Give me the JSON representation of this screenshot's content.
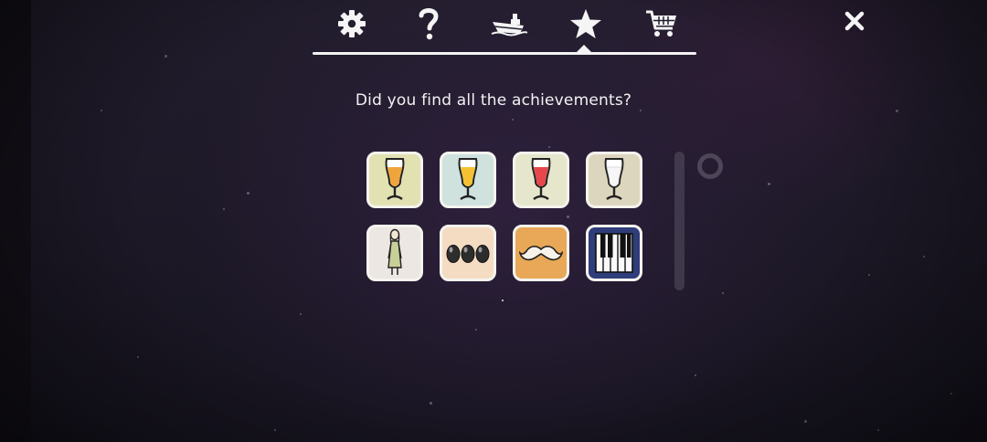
{
  "nav": {
    "tabs": [
      {
        "icon": "gear-icon",
        "active": false
      },
      {
        "icon": "help-icon",
        "active": false
      },
      {
        "icon": "boat-icon",
        "active": false
      },
      {
        "icon": "star-icon",
        "active": true
      },
      {
        "icon": "cart-icon",
        "active": false
      }
    ],
    "close_icon": "close-icon"
  },
  "prompt": "Did you find all the achievements?",
  "achievements": [
    {
      "icon": "orange-cocktail-glass-icon",
      "bg": "#e2e1b2",
      "liquid": "#f0a43c"
    },
    {
      "icon": "yellow-cocktail-glass-icon",
      "bg": "#cfe2dd",
      "liquid": "#f4c132"
    },
    {
      "icon": "red-cocktail-glass-icon",
      "bg": "#e5e6cb",
      "liquid": "#e5474b"
    },
    {
      "icon": "white-cocktail-glass-icon",
      "bg": "#ddd6be",
      "liquid": "#f6f6f6"
    },
    {
      "icon": "woman-figure-icon",
      "bg": "#ece7e2"
    },
    {
      "icon": "three-eggs-icon",
      "bg": "#f4dcc3"
    },
    {
      "icon": "mustache-icon",
      "bg": "#e8a857"
    },
    {
      "icon": "piano-keys-icon",
      "bg": "#2f3d7a"
    }
  ]
}
